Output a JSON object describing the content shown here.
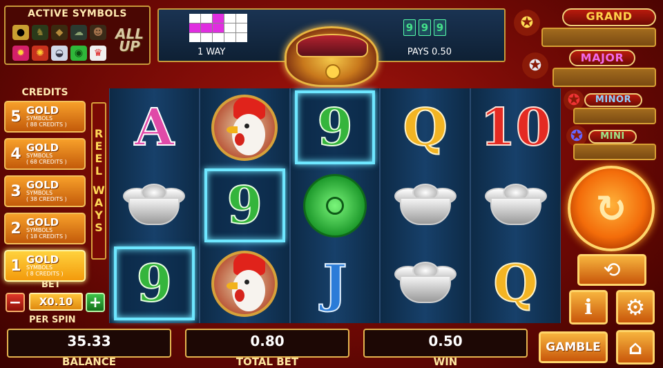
{
  "active_symbols": {
    "title": "ACTIVE SYMBOLS",
    "row1": [
      "coin-icon",
      "horse-icon",
      "tiger-icon",
      "sheep-icon",
      "monkey-icon"
    ],
    "row2": [
      "rooster-icon",
      "dog-icon",
      "pig-icon",
      "rat-icon",
      "ox-icon"
    ],
    "allup": "ALL UP"
  },
  "payline": {
    "pattern": [
      0,
      0,
      1,
      0,
      0,
      1,
      1,
      1,
      0,
      0,
      0,
      0,
      0,
      0,
      0
    ],
    "way_label": "1 WAY",
    "digits": [
      "9",
      "9",
      "9"
    ],
    "pays_label": "PAYS 0.50"
  },
  "jackpots": [
    {
      "label": "GRAND",
      "value": ""
    },
    {
      "label": "MAJOR",
      "value": ""
    },
    {
      "label": "MINOR",
      "value": ""
    },
    {
      "label": "MINI",
      "value": ""
    }
  ],
  "credits": {
    "title": "CREDITS",
    "options": [
      {
        "n": "5",
        "gold": "GOLD",
        "symbols": "SYMBOLS",
        "credits": "( 88 CREDITS )"
      },
      {
        "n": "4",
        "gold": "GOLD",
        "symbols": "SYMBOLS",
        "credits": "( 68 CREDITS )"
      },
      {
        "n": "3",
        "gold": "GOLD",
        "symbols": "SYMBOLS",
        "credits": "( 38 CREDITS )"
      },
      {
        "n": "2",
        "gold": "GOLD",
        "symbols": "SYMBOLS",
        "credits": "( 18 CREDITS )"
      },
      {
        "n": "1",
        "gold": "GOLD",
        "symbols": "SYMBOLS",
        "credits": "( 8 CREDITS )"
      }
    ],
    "selected_index": 4
  },
  "reel_ways": [
    "R",
    "E",
    "E",
    "L",
    " ",
    "W",
    "A",
    "Y",
    "S"
  ],
  "bet": {
    "label": "BET",
    "value": "X0.10",
    "minus": "−",
    "plus": "+",
    "per_spin": "PER SPIN"
  },
  "reels": [
    [
      "A",
      "ingot",
      "9"
    ],
    [
      "rooster",
      "9",
      "rooster"
    ],
    [
      "9",
      "jade",
      "J"
    ],
    [
      "Q",
      "ingot",
      "ingot"
    ],
    [
      "10",
      "ingot",
      "Q"
    ]
  ],
  "winning_cells": [
    [
      0,
      2
    ],
    [
      1,
      1
    ],
    [
      2,
      0
    ]
  ],
  "stats": [
    {
      "value": "35.33",
      "label": "BALANCE"
    },
    {
      "value": "0.80",
      "label": "TOTAL BET"
    },
    {
      "value": "0.50",
      "label": "WIN"
    }
  ],
  "buttons": {
    "gamble": "GAMBLE",
    "info": "i",
    "settings": "⚙",
    "home": "⌂",
    "autoplay": "⟲",
    "spin": "↻"
  }
}
